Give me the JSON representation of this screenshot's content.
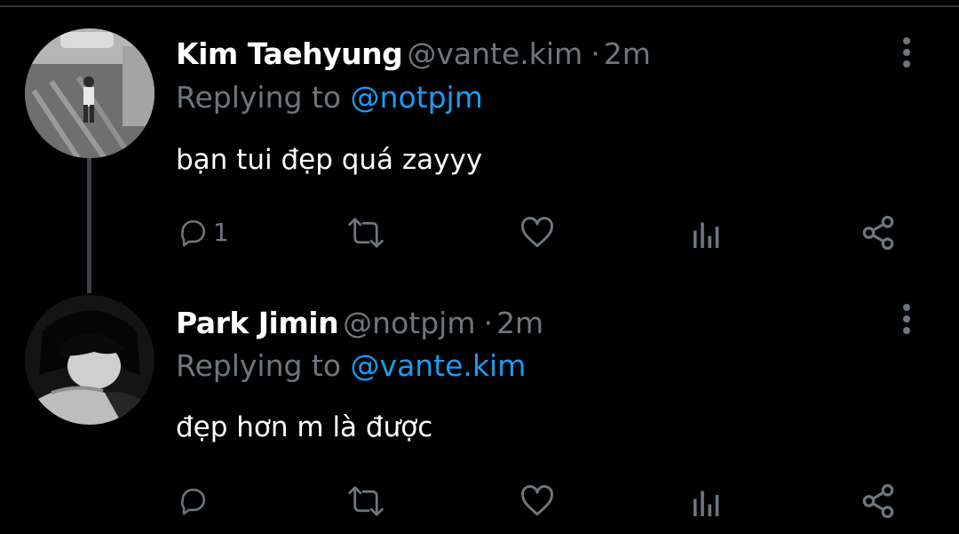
{
  "theme": {
    "background": "#000000",
    "text_primary": "#ffffff",
    "text_secondary": "#6e767d",
    "accent": "#1d9bf0",
    "thread_line": "#3d4247"
  },
  "tweets": [
    {
      "author_name": "Kim Taehyung",
      "handle": "@vante.kim",
      "separator": "·",
      "time": "2m",
      "replying_prefix": "Replying to",
      "replying_to": "@notpjm",
      "text": "bạn tui đẹp quá zayyy",
      "reply_count": "1",
      "avatar": "photo-person-on-street",
      "icons": [
        "reply-icon",
        "retweet-icon",
        "like-icon",
        "analytics-icon",
        "share-icon",
        "more-icon"
      ]
    },
    {
      "author_name": "Park Jimin",
      "handle": "@notpjm",
      "separator": "·",
      "time": "2m",
      "replying_prefix": "Replying to",
      "replying_to": "@vante.kim",
      "text": "đẹp hơn m là được",
      "reply_count": "",
      "avatar": "photo-person-dark-hair",
      "icons": [
        "reply-icon",
        "retweet-icon",
        "like-icon",
        "analytics-icon",
        "share-icon",
        "more-icon"
      ]
    }
  ]
}
